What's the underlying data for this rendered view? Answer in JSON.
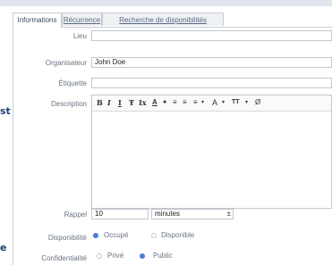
{
  "tabs": [
    {
      "label": "Informations",
      "active": true
    },
    {
      "label": "Récurrence",
      "active": false
    },
    {
      "label": "Recherche de disponibilités",
      "active": false
    }
  ],
  "form": {
    "lieu_label": "Lieu",
    "lieu_value": "",
    "organisateur_label": "Organisateur",
    "organisateur_value": "John Doe",
    "etiquette_label": "Étiquette",
    "etiquette_value": "",
    "description_label": "Description",
    "description_value": "",
    "rappel_label": "Rappel",
    "rappel_value": "10",
    "rappel_unit": "minutes",
    "disponibilite_label": "Disponibilité",
    "disponibilite_options": [
      "Occupé",
      "Disponible"
    ],
    "disponibilite_selected": "Occupé",
    "confidentialite_label": "Confidentialité",
    "confidentialite_options": [
      "Privé",
      "Public"
    ],
    "confidentialite_selected": "Public"
  },
  "toolbar": {
    "bold": "B",
    "italic": "I",
    "underline": "I",
    "strike": "Ŧ",
    "clear": "Ix",
    "font_color": "A",
    "highlight": "●",
    "list_bullet": "≡",
    "list_number": "≡",
    "align": "≡",
    "font_size": "A",
    "text_height": "TT",
    "attach": "Ø"
  },
  "left_fragments": [
    "st",
    "e"
  ],
  "colors": {
    "accent": "#4a7fd4",
    "border": "#c2c8cf",
    "label": "#6a7480"
  }
}
